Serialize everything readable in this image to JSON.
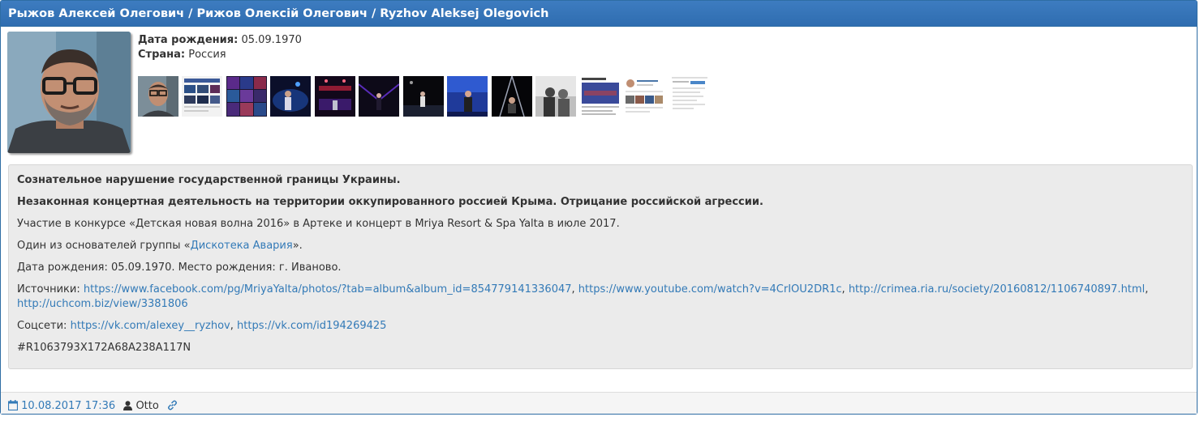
{
  "header": {
    "title": "Рыжов Алексей Олегович / Рижов Олексій Олегович / Ryzhov Aleksej Olegovich"
  },
  "meta": {
    "birth_label": "Дата рождения:",
    "birth_value": "05.09.1970",
    "country_label": "Страна:",
    "country_value": "Россия"
  },
  "thumbnails": [
    {
      "name": "thumb-portrait"
    },
    {
      "name": "thumb-screenshot-album"
    },
    {
      "name": "thumb-concert-collage"
    },
    {
      "name": "thumb-stage-blue"
    },
    {
      "name": "thumb-stage-red"
    },
    {
      "name": "thumb-stage-purple"
    },
    {
      "name": "thumb-stage-dark"
    },
    {
      "name": "thumb-stage-singer"
    },
    {
      "name": "thumb-stage-lights"
    },
    {
      "name": "thumb-bw-photo"
    },
    {
      "name": "thumb-article-photo"
    },
    {
      "name": "thumb-social-profile"
    },
    {
      "name": "thumb-document"
    }
  ],
  "body": {
    "line1": "Сознательное нарушение государственной границы Украины.",
    "line2": "Незаконная концертная деятельность на территории оккупированного россией Крыма. Отрицание российской агрессии.",
    "line3": "Участие в конкурсе «Детская новая волна 2016» в Артеке и концерт в Mriya Resort & Spa Yalta в июле 2017.",
    "line4_prefix": "Один из основателей группы «",
    "line4_link": "Дискотека Авария",
    "line4_suffix": "».",
    "line5": "Дата рождения: 05.09.1970. Место рождения: г. Иваново.",
    "sources_label": "Источники:",
    "sources": [
      "https://www.facebook.com/pg/MriyaYalta/photos/?tab=album&album_id=854779141336047",
      "https://www.youtube.com/watch?v=4CrIOU2DR1c",
      "http://crimea.ria.ru/society/20160812/1106740897.html",
      "http://uchcom.biz/view/3381806"
    ],
    "socials_label": "Соцсети:",
    "socials": [
      "https://vk.com/alexey__ryzhov",
      "https://vk.com/id194269425"
    ],
    "hashtag": "#R1063793X172A68A238A117N"
  },
  "footer": {
    "date": "10.08.2017 17:36",
    "author": "Otto",
    "calendar_icon": "calendar-icon",
    "user_icon": "user-icon",
    "link_icon": "link-icon"
  },
  "colors": {
    "header_bg": "#3373b8",
    "link": "#337ab7",
    "well_bg": "#ebebeb"
  }
}
